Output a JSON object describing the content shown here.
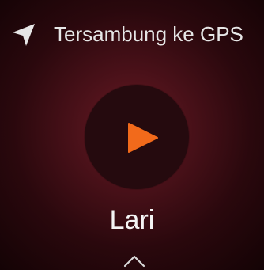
{
  "status": {
    "icon": "location-arrow-icon",
    "text": "Tersambung ke GPS"
  },
  "start": {
    "icon": "play-icon",
    "accent": "#f26a1b",
    "button_color": "#250a0e"
  },
  "activity": {
    "label": "Lari"
  },
  "nav": {
    "icon": "chevron-up-icon"
  },
  "colors": {
    "background_center": "#6a1a24",
    "background_edge": "#140305",
    "text": "#e6e6e6"
  }
}
